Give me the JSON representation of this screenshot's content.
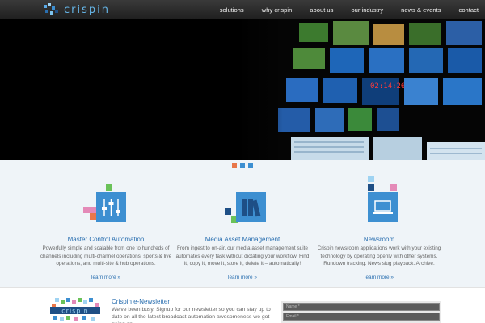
{
  "brand": {
    "name": "crispin"
  },
  "nav": {
    "items": [
      {
        "label": "solutions"
      },
      {
        "label": "why crispin"
      },
      {
        "label": "about us"
      },
      {
        "label": "our industry"
      },
      {
        "label": "news & events"
      },
      {
        "label": "contact"
      }
    ]
  },
  "colors": {
    "accent_blue": "#3d8fd1",
    "link_blue": "#2a6fb0",
    "pixel_green": "#6ac259",
    "pixel_pink": "#e48ab8",
    "pixel_orange": "#e8774a",
    "pixel_navy": "#1e4f86",
    "pixel_lightblue": "#9fd3f2"
  },
  "slider": {
    "dot_count": 3,
    "active": 0
  },
  "features": [
    {
      "icon": "sliders-icon",
      "title": "Master Control Automation",
      "text": "Powerfully simple and scalable from one to hundreds of channels including multi-channel operations, sports & live operations, and multi-site & hub operations.",
      "more": "learn more »"
    },
    {
      "icon": "books-icon",
      "title": "Media Asset Management",
      "text": "From ingest to on-air, our media asset management suite automates every task without dictating your workflow. Find it, copy it, move it, store it, delete it – automatically!",
      "more": "learn more »"
    },
    {
      "icon": "laptop-icon",
      "title": "Newsroom",
      "text": "Crispin newsroom applications work with your existing technology by operating openly with other systems. Rundown tracking. News slug playback. Archive.",
      "more": "learn more »"
    }
  ],
  "newsletter": {
    "title": "Crispin e-Newsletter",
    "text": "We've been busy. Signup for our newsletter so you can stay up to date on all the latest broadcast automation awesomeness we got going on.",
    "name_placeholder": "Name *",
    "email_placeholder": "Email *"
  }
}
